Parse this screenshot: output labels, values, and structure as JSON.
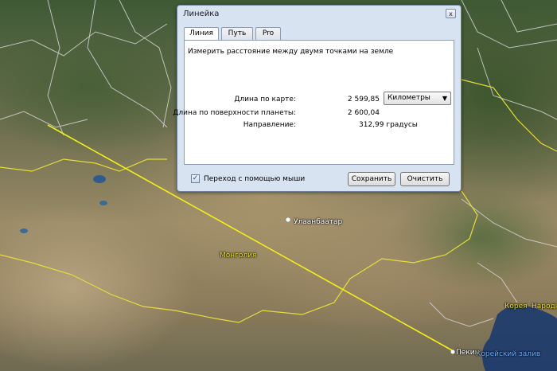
{
  "dialog": {
    "title": "Линейка",
    "close_glyph": "x",
    "tabs": [
      {
        "label": "Линия",
        "active": true
      },
      {
        "label": "Путь",
        "active": false
      },
      {
        "label": "Pro",
        "active": false
      }
    ],
    "description": "Измерить расстояние между двумя точками на земле",
    "map_length_label": "Длина по карте:",
    "map_length_value": "2 599,85",
    "unit_selected": "Километры",
    "ground_length_label": "Длина по поверхности планеты:",
    "ground_length_value": "2 600,04",
    "heading_label": "Направление:",
    "heading_value": "312,99 градусы",
    "mouse_nav_checked": true,
    "mouse_nav_label": "Переход с помощью мыши",
    "save_label": "Сохранить",
    "clear_label": "Очистить"
  },
  "map": {
    "labels": {
      "ulaanbaatar": "Улаанбаатар",
      "mongolia": "Монголия",
      "beijing": "Пекин",
      "korea": "Корея",
      "north_korea": "Народн",
      "bay": "Корейский залив"
    },
    "ruler_color": "#f2ee1c",
    "border_color": "#d8d8d8",
    "country_border_color": "#e6dc3c"
  }
}
